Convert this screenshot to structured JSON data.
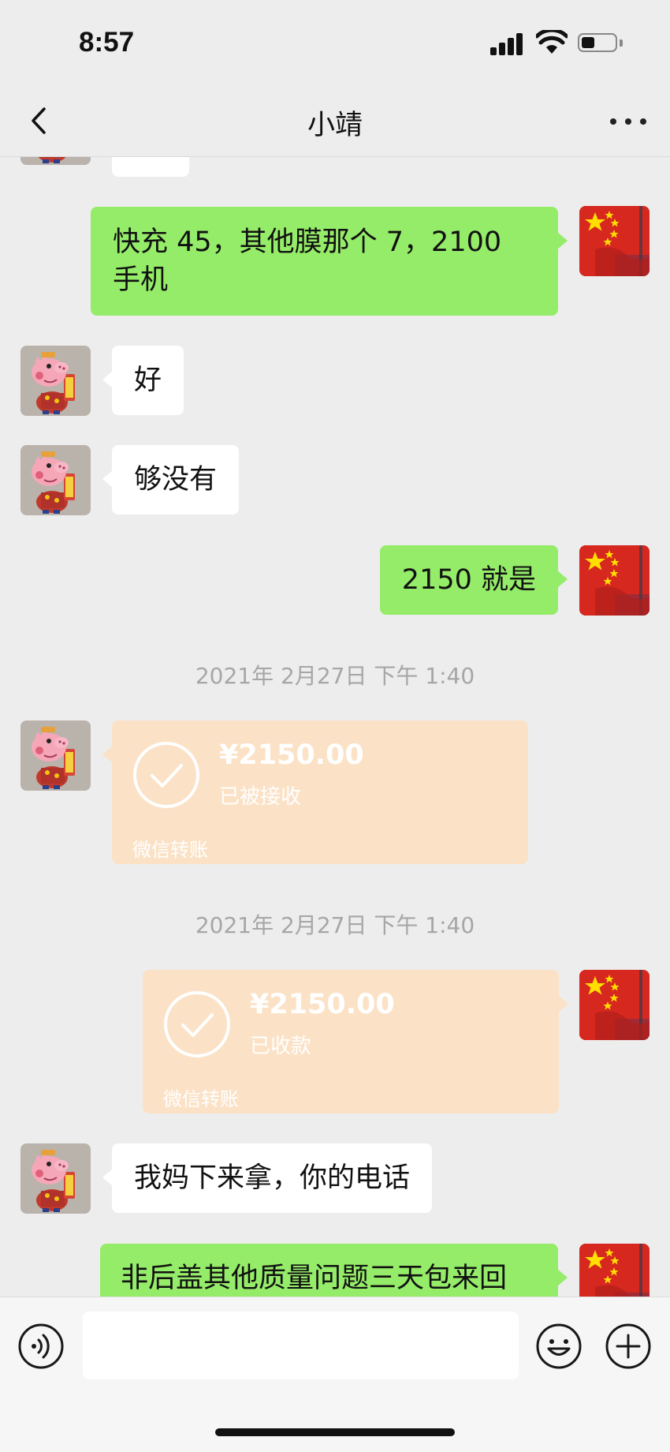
{
  "status_bar": {
    "time": "8:57"
  },
  "header": {
    "title": "小靖"
  },
  "messages": [
    {
      "from": "contact",
      "text": "好"
    },
    {
      "from": "contact",
      "text": "够没有"
    },
    {
      "from": "me",
      "text": "快充 45，其他膜那个 7，2100 手机"
    },
    {
      "from": "me",
      "text": "2150 就是"
    },
    {
      "from": "contact",
      "text": "我妈下来拿，你的电话"
    },
    {
      "from": "me",
      "text": "非后盖其他质量问题三天包来回"
    }
  ],
  "timestamps": [
    "2021年 2月27日 下午 1:40",
    "2021年 2月27日 下午 1:40"
  ],
  "transfers": [
    {
      "from": "contact",
      "amount": "¥2150.00",
      "status": "已被接收",
      "label": "微信转账"
    },
    {
      "from": "me",
      "amount": "¥2150.00",
      "status": "已收款",
      "label": "微信转账"
    }
  ],
  "input": {
    "placeholder": ""
  },
  "icons": [
    "back-icon",
    "more-icon",
    "voice-icon",
    "emoji-icon",
    "plus-icon",
    "checkmark-icon"
  ],
  "colors": {
    "outgoing_bubble": "#95ec69",
    "incoming_bubble": "#ffffff",
    "transfer_card": "#fbe2c6",
    "background": "#ededed"
  }
}
